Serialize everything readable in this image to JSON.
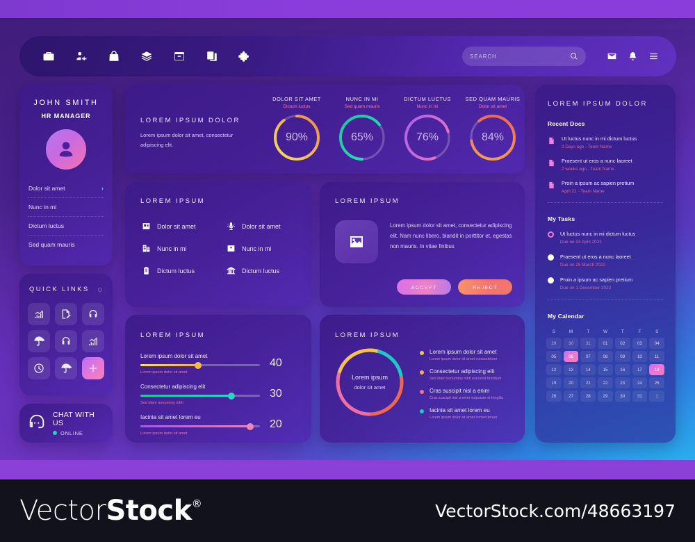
{
  "header": {
    "nav_icons": [
      "briefcase-icon",
      "user-settings-icon",
      "shopping-bag-icon",
      "layers-icon",
      "archive-box-icon",
      "copy-icon",
      "puzzle-piece-icon"
    ],
    "search": {
      "value": "",
      "placeholder": "SEARCH",
      "icon": "search-icon"
    },
    "actions": [
      "mail-icon",
      "bell-icon",
      "hamburger-menu-icon"
    ]
  },
  "profile": {
    "name": "JOHN SMITH",
    "role": "HR MANAGER",
    "avatar": "user-avatar-icon",
    "menu": [
      {
        "label": "Dolor sit amet",
        "chevron": "›"
      },
      {
        "label": "Nunc in mi",
        "chevron": ""
      },
      {
        "label": "Dictum luctus",
        "chevron": ""
      },
      {
        "label": "Sed quam mauris",
        "chevron": ""
      }
    ]
  },
  "quick_links": {
    "title": "QUICK LINKS",
    "items": [
      {
        "icon": "bar-chart-icon",
        "accent": false
      },
      {
        "icon": "edit-document-icon",
        "accent": false
      },
      {
        "icon": "headset-icon",
        "accent": false
      },
      {
        "icon": "umbrella-icon",
        "accent": false
      },
      {
        "icon": "headphones-icon",
        "accent": false
      },
      {
        "icon": "bar-chart-icon",
        "accent": false
      },
      {
        "icon": "clock-icon",
        "accent": false
      },
      {
        "icon": "umbrella-icon",
        "accent": false
      },
      {
        "icon": "plus-icon",
        "accent": true
      }
    ]
  },
  "chat": {
    "title": "CHAT WITH US",
    "status": "ONLINE",
    "status_color": "#23d6b0",
    "icon": "headset-icon"
  },
  "stats": {
    "title": "LOREM IPSUM DOLOR",
    "description": "Lorem ipsum dolor sit amet, consectetur adipiscing elit.",
    "gauges": [
      {
        "title": "DOLOR SIT AMET",
        "subtitle": "Dictum luctus",
        "value": "90%",
        "percent": 90,
        "color_from": "#f7e05c",
        "color_to": "#f08a4b"
      },
      {
        "title": "NUNC IN MI",
        "subtitle": "Sed quam mauris",
        "value": "65%",
        "percent": 65,
        "color_from": "#19c79a",
        "color_to": "#2ce0c0"
      },
      {
        "title": "DICTUM LUCTUS",
        "subtitle": "Nunc in mi",
        "value": "76%",
        "percent": 76,
        "color_from": "#a95ef0",
        "color_to": "#f27ab6"
      },
      {
        "title": "SED QUAM MAURIS",
        "subtitle": "Dolor sit amet",
        "value": "84%",
        "percent": 84,
        "color_from": "#f6a552",
        "color_to": "#f0604f"
      }
    ]
  },
  "icon_list": {
    "title": "LOREM IPSUM",
    "items": [
      {
        "label": "Dolor sit amet",
        "icon": "id-card-icon"
      },
      {
        "label": "Dolor sit amet",
        "icon": "microphone-icon"
      },
      {
        "label": "Nunc in mi",
        "icon": "building-icon"
      },
      {
        "label": "Nunc in mi",
        "icon": "contact-card-icon"
      },
      {
        "label": "Dictum luctus",
        "icon": "clipboard-icon"
      },
      {
        "label": "Dictum luctus",
        "icon": "bank-icon"
      }
    ]
  },
  "media": {
    "title": "LOREM IPSUM",
    "thumb_icon": "image-icon",
    "text": "Lorem ipsum dolor sit amet, consectetur adipiscing elit. Nam nunc libero, blandit in porttitor et, egestas non mauris. In vitae finibus",
    "accept_label": "ACCEPT",
    "reject_label": "REJECT"
  },
  "sliders": {
    "title": "LOREM IPSUM",
    "rows": [
      {
        "label": "Lorem ipsum dolor sit amet",
        "sub": "Lorem ipsum dolor sit amet",
        "value": "40",
        "percent": 48,
        "color_from": "#f5e05f",
        "color_to": "#f2ac4e",
        "knob": "#f4b84e"
      },
      {
        "label": "Consectetur adipiscing elit",
        "sub": "Sed diam nonummy nibh",
        "value": "30",
        "percent": 76,
        "color_from": "#1cc994",
        "color_to": "#2ad6c4",
        "knob": "#2ad4bd"
      },
      {
        "label": "Iacinia sit amet lorem eu",
        "sub": "Lorem ipsum dolor sit amet",
        "value": "20",
        "percent": 92,
        "color_from": "#a05af0",
        "color_to": "#ef82b8",
        "knob": "#ef86ba"
      }
    ]
  },
  "donut_card": {
    "title": "LOREM IPSUM",
    "center_line1": "Lorem ipsum",
    "center_line2": "dolor sit amet",
    "legend": [
      {
        "label": "Lorem ipsum dolor sit amet",
        "sub": "Lorem ipsum dolor sit amet consectetuer",
        "color": "#f4c34e"
      },
      {
        "label": "Consectetur adipiscing elit",
        "sub": "Sed diam nonummy nibh euismod tincidunt",
        "color": "#f4b04e"
      },
      {
        "label": "Cras suscipit nisl a enim",
        "sub": "Cras suscipit nisl a enim vulputate et fringilla",
        "color": "#ef6fa4"
      },
      {
        "label": "Iacinia sit amet lorem eu",
        "sub": "Lorem ipsum dolor sit amet consectetuer",
        "color": "#1fc8c4"
      }
    ]
  },
  "chart_data": {
    "type": "pie",
    "title": "LOREM IPSUM",
    "labels": [
      "Lorem ipsum dolor sit amet",
      "Consectetur adipiscing elit",
      "Cras suscipit nisl a enim",
      "Iacinia sit amet lorem eu"
    ],
    "values": [
      22,
      26,
      28,
      24
    ],
    "colors": [
      "#f4c34e",
      "#f0664f",
      "#ef6fa4",
      "#1fc8c4"
    ],
    "legend_position": "right",
    "center_text": "Lorem ipsum dolor sit amet"
  },
  "right_panel": {
    "title": "LOREM IPSUM DOLOR",
    "recent_docs_heading": "Recent Docs",
    "recent_docs": [
      {
        "title": "Ut luctus nunc in mi dictum luctus",
        "meta": "3 Days ago - Team Name",
        "icon": "document-icon"
      },
      {
        "title": "Praesent ut eros a nunc laoreet",
        "meta": "2 weeks ago - Team Name",
        "icon": "document-icon"
      },
      {
        "title": "Proin a ipsum ac sapien pretium",
        "meta": "April 21 - Team Name",
        "icon": "document-icon"
      }
    ],
    "tasks_heading": "My Tasks",
    "tasks": [
      {
        "title": "Ut luctus nunc in mi dictum luctus",
        "meta": "Due on 24 April 2022",
        "active": true
      },
      {
        "title": "Praesent ut eros a nunc laoreet",
        "meta": "Due on 25 March 2022",
        "active": false
      },
      {
        "title": "Proin a ipsum ac sapien pretium",
        "meta": "Due on 1 December 2022",
        "active": false
      }
    ],
    "calendar_heading": "My Calendar",
    "calendar": {
      "weekdays": [
        "S",
        "M",
        "T",
        "W",
        "T",
        "F",
        "S"
      ],
      "weeks": [
        [
          {
            "d": "29",
            "m": true
          },
          {
            "d": "30",
            "m": true
          },
          {
            "d": "31",
            "m": true
          },
          {
            "d": "01",
            "m": false
          },
          {
            "d": "02",
            "m": false
          },
          {
            "d": "03",
            "m": false
          },
          {
            "d": "04",
            "m": false
          }
        ],
        [
          {
            "d": "05",
            "m": false
          },
          {
            "d": "06",
            "m": false,
            "hl": true
          },
          {
            "d": "07",
            "m": false
          },
          {
            "d": "08",
            "m": false
          },
          {
            "d": "09",
            "m": false
          },
          {
            "d": "10",
            "m": false
          },
          {
            "d": "11",
            "m": false
          }
        ],
        [
          {
            "d": "12",
            "m": false
          },
          {
            "d": "13",
            "m": false
          },
          {
            "d": "14",
            "m": false
          },
          {
            "d": "15",
            "m": false
          },
          {
            "d": "16",
            "m": false
          },
          {
            "d": "17",
            "m": false
          },
          {
            "d": "18",
            "m": false,
            "hl": true
          }
        ],
        [
          {
            "d": "19",
            "m": false
          },
          {
            "d": "20",
            "m": false
          },
          {
            "d": "21",
            "m": false
          },
          {
            "d": "22",
            "m": false
          },
          {
            "d": "23",
            "m": false
          },
          {
            "d": "24",
            "m": false
          },
          {
            "d": "25",
            "m": false
          }
        ],
        [
          {
            "d": "26",
            "m": false
          },
          {
            "d": "27",
            "m": false
          },
          {
            "d": "28",
            "m": false
          },
          {
            "d": "29",
            "m": false
          },
          {
            "d": "30",
            "m": false
          },
          {
            "d": "31",
            "m": false
          },
          {
            "d": "1",
            "m": true
          }
        ]
      ]
    }
  },
  "footer": {
    "logo_thin": "Vector",
    "logo_bold": "Stock",
    "logo_reg": "®",
    "url": "VectorStock.com/48663197"
  }
}
